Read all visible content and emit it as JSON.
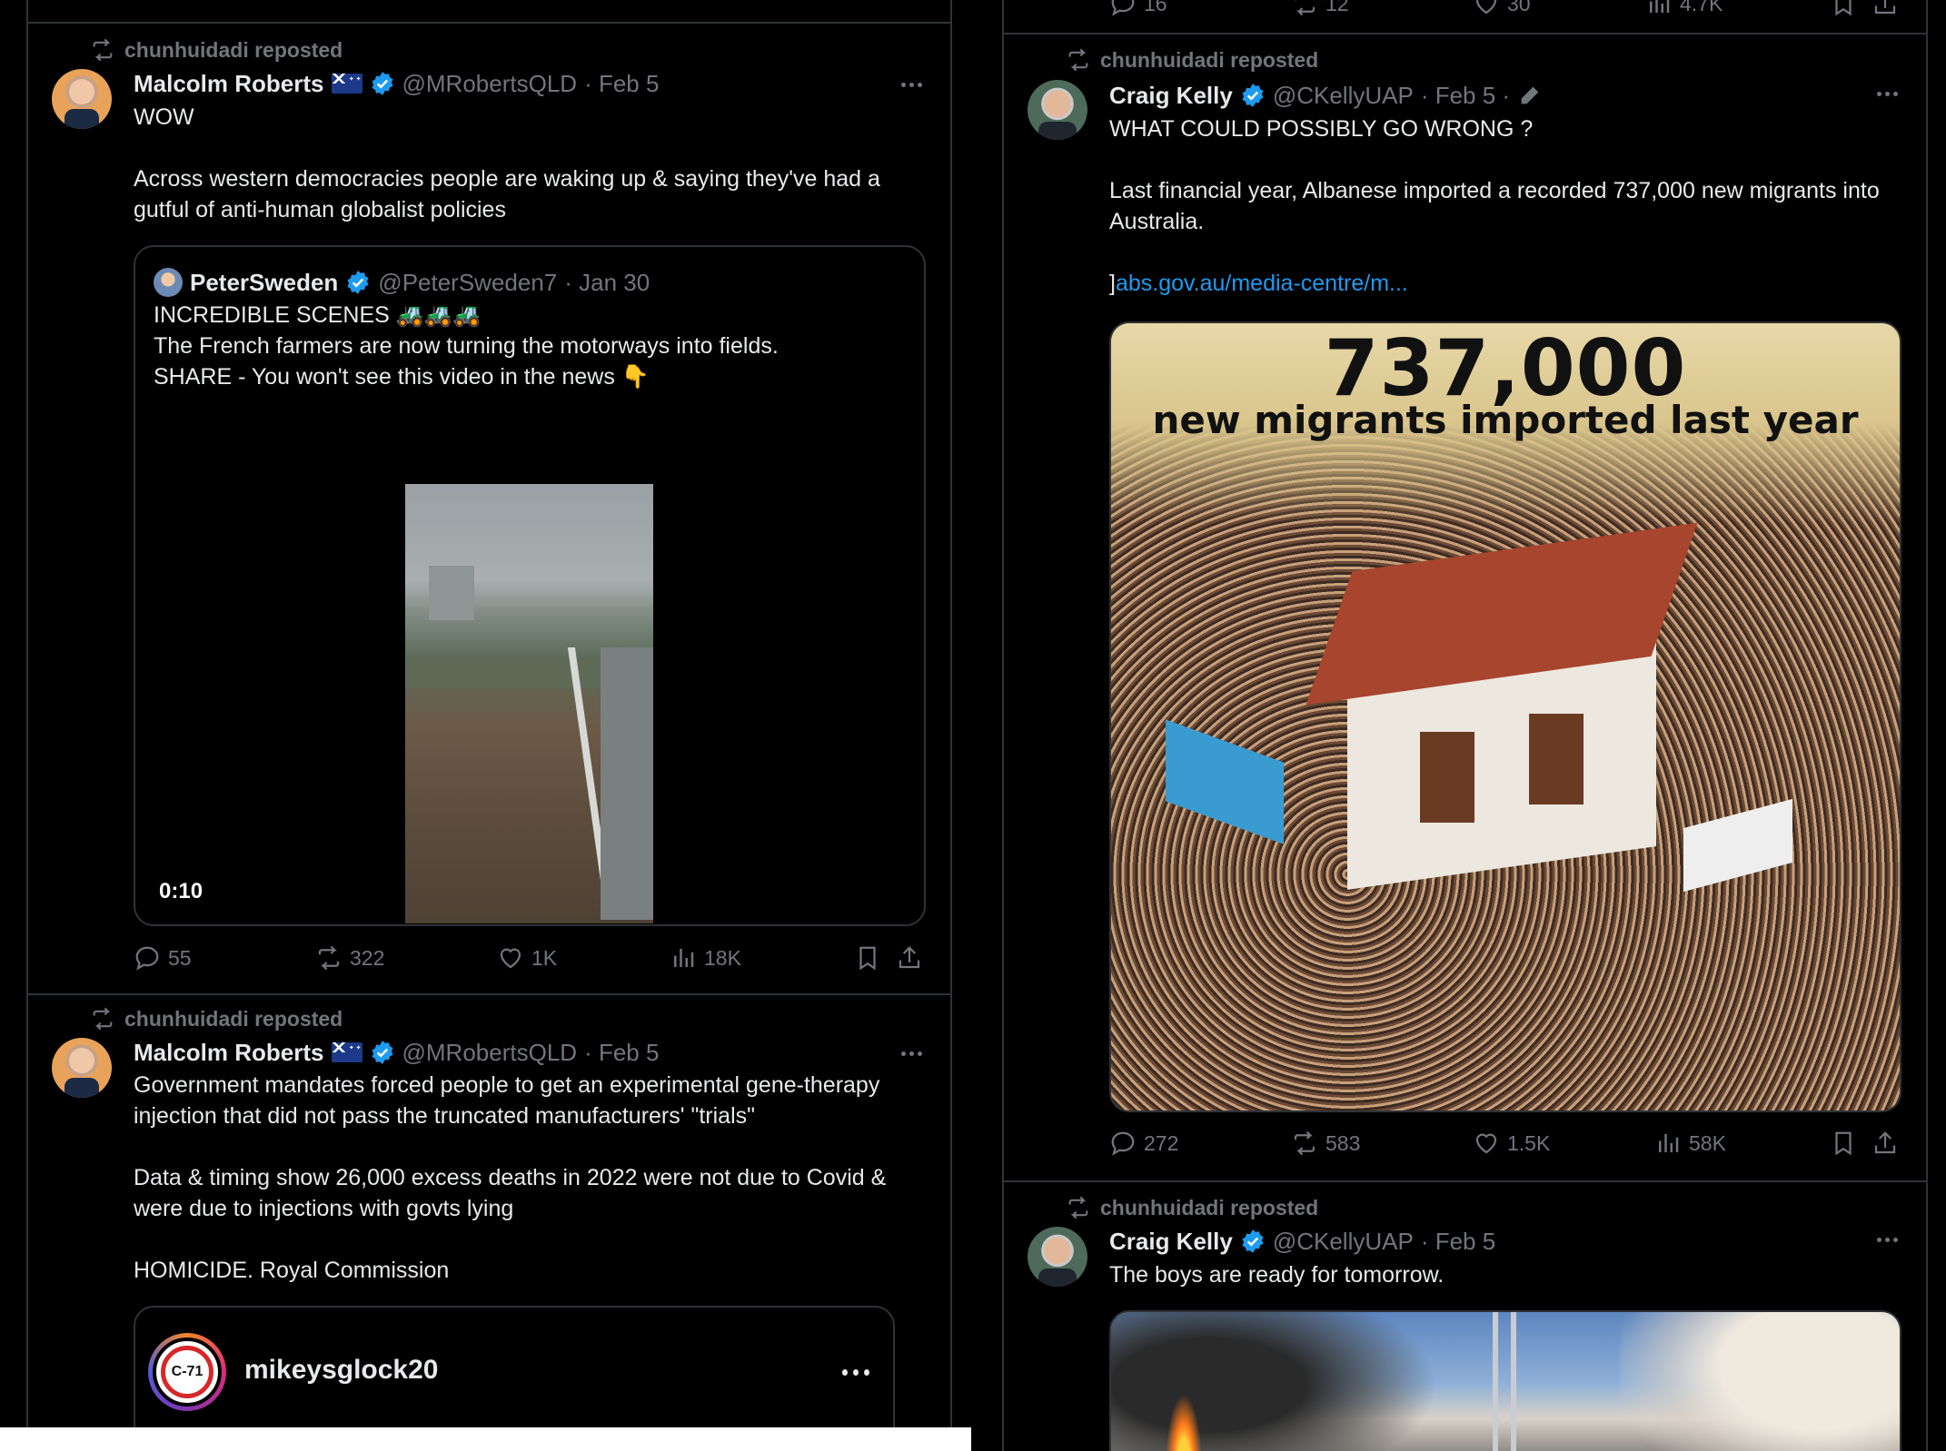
{
  "icons": {
    "repost": "repost-icon",
    "verified": "verified-badge-icon",
    "reply": "reply-icon",
    "retweet": "retweet-icon",
    "like": "heart-icon",
    "views": "bar-chart-icon",
    "bookmark": "bookmark-icon",
    "share": "share-icon",
    "more": "more-dots-icon",
    "edit": "pencil-icon"
  },
  "colors": {
    "background": "#000000",
    "text": "#e7e9ea",
    "muted": "#71767b",
    "link": "#1d9bf0",
    "verified": "#1d9bf0",
    "border": "#2f3336"
  },
  "left_col": {
    "top_partial_stats": {},
    "post1": {
      "repost_label": "chunhuidadi reposted",
      "name": "Malcolm Roberts",
      "handle": "@MRobertsQLD",
      "date": "· Feb 5",
      "text": [
        "WOW",
        "",
        "Across western democracies people are waking up & saying they've had a gutful of anti-human globalist policies"
      ],
      "quote": {
        "name": "PeterSweden",
        "handle": "@PeterSweden7",
        "date": "· Jan 30",
        "text": [
          "INCREDIBLE SCENES 🚜🚜🚜",
          "",
          "The French farmers are now turning the motorways into fields.",
          "",
          "SHARE - You won't see this video in the news 👇"
        ],
        "video_duration": "0:10"
      },
      "stats": {
        "replies": "55",
        "reposts": "322",
        "likes": "1K",
        "views": "18K"
      }
    },
    "post2": {
      "repost_label": "chunhuidadi reposted",
      "name": "Malcolm Roberts",
      "handle": "@MRobertsQLD",
      "date": "· Feb 5",
      "text": [
        "Government mandates forced people to get an experimental gene-therapy injection that did not pass the truncated manufacturers' \"trials\"",
        "",
        "Data & timing show 26,000 excess deaths in 2022 were not due to Covid & were due to injections with govts lying",
        "",
        "HOMICIDE. Royal Commission"
      ],
      "embed": {
        "username": "mikeysglock20",
        "avatar_text": "C-71"
      }
    }
  },
  "right_col": {
    "top_partial_stats": {
      "replies": "16",
      "reposts": "12",
      "likes": "30",
      "views": "4.7K"
    },
    "post1": {
      "repost_label": "chunhuidadi reposted",
      "name": "Craig Kelly",
      "handle": "@CKellyUAP",
      "date": "· Feb 5 ·",
      "text": [
        "WHAT COULD POSSIBLY GO WRONG ?",
        "",
        "Last financial year, Albanese imported a recorded 737,000 new migrants into Australia.",
        ""
      ],
      "link_prefix": "]",
      "link": "abs.gov.au/media-centre/m...",
      "image_headline": "737,000",
      "image_subline": "new migrants imported  last year",
      "stats": {
        "replies": "272",
        "reposts": "583",
        "likes": "1.5K",
        "views": "58K"
      }
    },
    "post2": {
      "repost_label": "chunhuidadi reposted",
      "name": "Craig Kelly",
      "handle": "@CKellyUAP",
      "date": "· Feb 5",
      "text": [
        "The boys are ready for tomorrow."
      ]
    }
  }
}
